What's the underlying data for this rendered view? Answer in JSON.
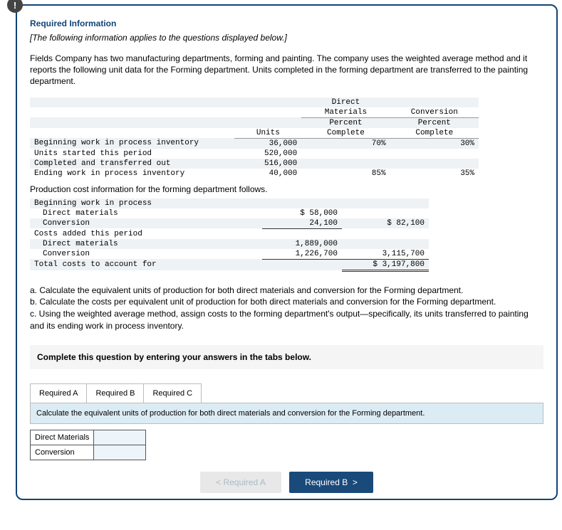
{
  "header": {
    "badge": "!",
    "title": "Required Information",
    "intro": "[The following information applies to the questions displayed below.]",
    "body": "Fields Company has two manufacturing departments, forming and painting. The company uses the weighted average method and it reports the following unit data for the Forming department. Units completed in the forming department are transferred to the painting department."
  },
  "units_table": {
    "cols": {
      "units": "Units",
      "dm_head1": "Direct",
      "dm_head2": "Materials",
      "dm_head3": "Percent",
      "dm_head4": "Complete",
      "cv_head1": "Conversion",
      "cv_head2": "Percent",
      "cv_head3": "Complete"
    },
    "rows": [
      {
        "label": "Beginning work in process inventory",
        "units": "36,000",
        "dm": "70%",
        "cv": "30%"
      },
      {
        "label": "Units started this period",
        "units": "520,000",
        "dm": "",
        "cv": ""
      },
      {
        "label": "Completed and transferred out",
        "units": "516,000",
        "dm": "",
        "cv": ""
      },
      {
        "label": "Ending work in process inventory",
        "units": "40,000",
        "dm": "85%",
        "cv": "35%"
      }
    ]
  },
  "section2_caption": "Production cost information for the forming department follows.",
  "cost_table": {
    "rows": {
      "bwip": "Beginning work in process",
      "bwip_dm": "Direct materials",
      "bwip_dm_v": "$ 58,000",
      "bwip_cv": "Conversion",
      "bwip_cv_v": "24,100",
      "bwip_tot": "$ 82,100",
      "costs": "Costs added this period",
      "ca_dm": "Direct materials",
      "ca_dm_v": "1,889,000",
      "ca_cv": "Conversion",
      "ca_cv_v": "1,226,700",
      "ca_tot": "3,115,700",
      "grand": "Total costs to account for",
      "grand_v": "$ 3,197,800"
    }
  },
  "questions": {
    "a": "a. Calculate the equivalent units of production for both direct materials and conversion for the Forming department.",
    "b": "b. Calculate the costs per equivalent unit of production for both direct materials and conversion for the Forming department.",
    "c": "c. Using the weighted average method, assign costs to the forming department's output—specifically, its units transferred to painting and its ending work in process inventory."
  },
  "answer_band": "Complete this question by entering your answers in the tabs below.",
  "tabs": {
    "a": "Required A",
    "b": "Required B",
    "c": "Required C",
    "instruction": "Calculate the equivalent units of production for both direct materials and conversion for the Forming department."
  },
  "input_rows": {
    "dm": "Direct Materials",
    "cv": "Conversion"
  },
  "nav": {
    "prev": "Required A",
    "next": "Required B"
  },
  "chart_data": {
    "type": "table",
    "units": [
      {
        "item": "Beginning work in process inventory",
        "units": 36000,
        "dm_pct": 70,
        "cv_pct": 30
      },
      {
        "item": "Units started this period",
        "units": 520000
      },
      {
        "item": "Completed and transferred out",
        "units": 516000
      },
      {
        "item": "Ending work in process inventory",
        "units": 40000,
        "dm_pct": 85,
        "cv_pct": 35
      }
    ],
    "costs": {
      "beginning_wip": {
        "direct_materials": 58000,
        "conversion": 24100,
        "subtotal": 82100
      },
      "added_this_period": {
        "direct_materials": 1889000,
        "conversion": 1226700,
        "subtotal": 3115700
      },
      "total_costs_to_account_for": 3197800
    }
  }
}
